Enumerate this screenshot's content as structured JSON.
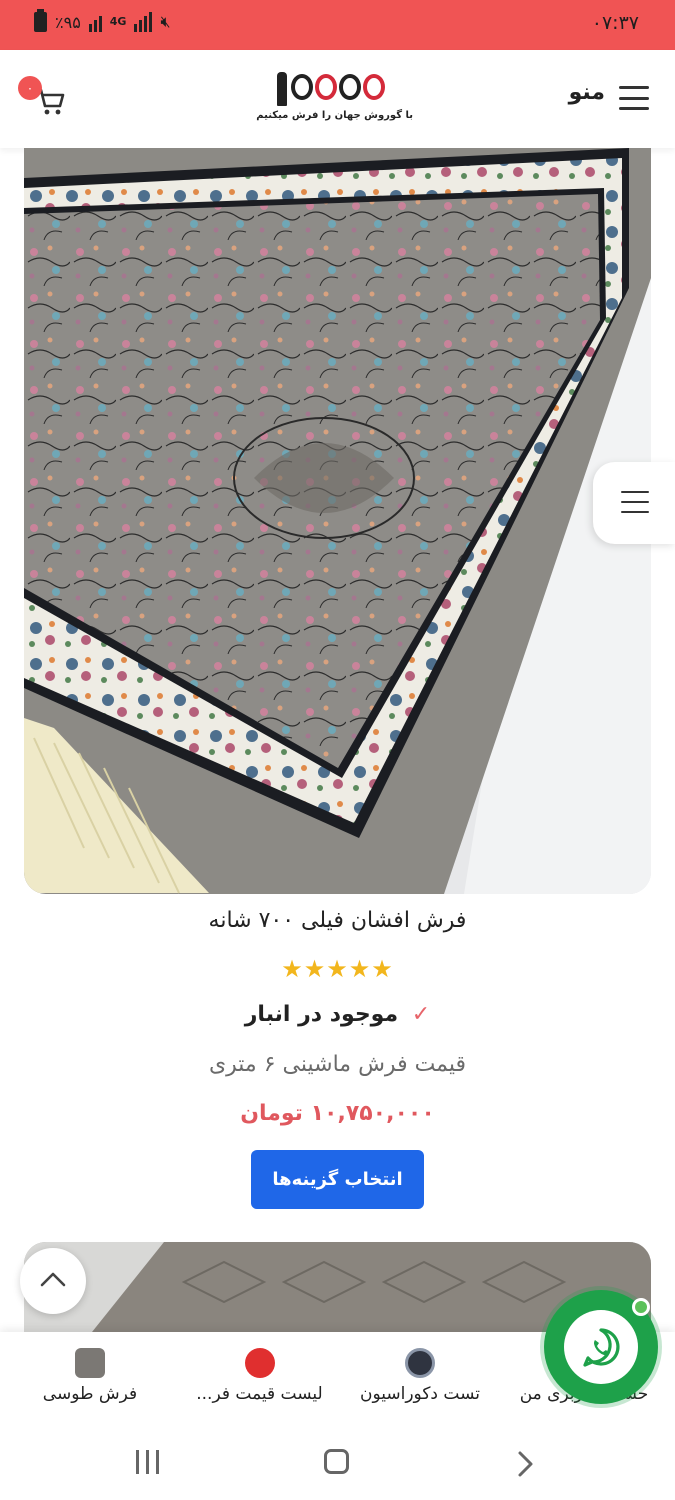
{
  "status_bar": {
    "time": "۰۷:۳۷",
    "battery": "٪۹۵",
    "network": "4G"
  },
  "header": {
    "menu_label": "منو",
    "logo_tagline": "با گوروش جهان را فرش میکنیم",
    "cart_count": "۰"
  },
  "product": {
    "title": "فرش افشان فیلی ۷۰۰ شانه",
    "rating": 5,
    "stars": "★★★★★",
    "stock_check": "✓",
    "stock_status": "موجود در انبار",
    "subtitle": "قیمت فرش ماشینی ۶ متری",
    "price": "۱۰,۷۵۰,۰۰۰ تومان",
    "button_label": "انتخاب گزینه‌ها"
  },
  "bottom_categories": [
    {
      "label": "فرش طوسی"
    },
    {
      "label": "لیست قیمت فر..."
    },
    {
      "label": "تست دکوراسیون"
    },
    {
      "label": "حساب کاربری من"
    }
  ],
  "colors": {
    "status_bar": "#f05454",
    "accent_blue": "#1f67e8",
    "price_red": "#e0585e",
    "star_gold": "#f2b61d",
    "whatsapp_green": "#1ea14a"
  },
  "icons": [
    "battery-icon",
    "signal-icon",
    "cart-icon",
    "hamburger-icon",
    "check-icon",
    "star-icon",
    "chevron-up-icon",
    "whatsapp-icon",
    "recent-apps-icon",
    "home-icon",
    "back-icon"
  ]
}
